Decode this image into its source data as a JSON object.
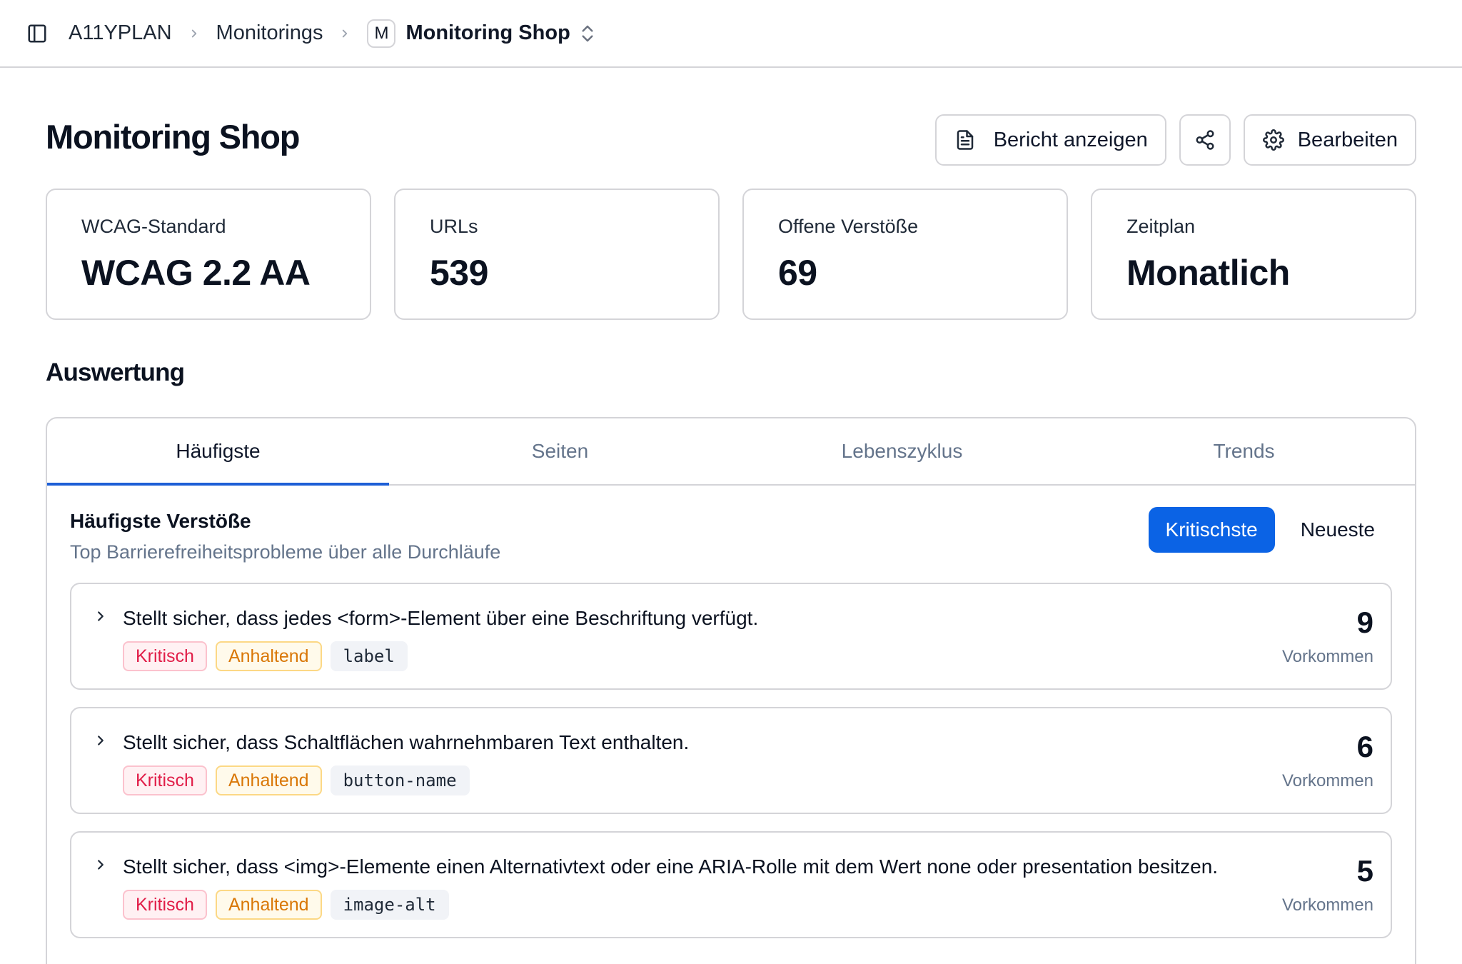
{
  "breadcrumb": {
    "org": "A11YPLAN",
    "section": "Monitorings",
    "badge": "M",
    "current": "Monitoring Shop"
  },
  "header": {
    "title": "Monitoring Shop",
    "report_label": "Bericht anzeigen",
    "edit_label": "Bearbeiten"
  },
  "stats": [
    {
      "label": "WCAG-Standard",
      "value": "WCAG 2.2 AA"
    },
    {
      "label": "URLs",
      "value": "539"
    },
    {
      "label": "Offene Verstöße",
      "value": "69"
    },
    {
      "label": "Zeitplan",
      "value": "Monatlich"
    }
  ],
  "section": {
    "title": "Auswertung"
  },
  "tabs": [
    {
      "label": "Häufigste",
      "active": true
    },
    {
      "label": "Seiten",
      "active": false
    },
    {
      "label": "Lebenszyklus",
      "active": false
    },
    {
      "label": "Trends",
      "active": false
    }
  ],
  "panel": {
    "title": "Häufigste Verstöße",
    "subtitle": "Top Barrierefreiheitsprobleme über alle Durchläufe",
    "sort_critical": "Kritischste",
    "sort_newest": "Neueste"
  },
  "issues": [
    {
      "title": "Stellt sicher, dass jedes <form>-Element über eine Beschriftung verfügt.",
      "severity": "Kritisch",
      "status": "Anhaltend",
      "rule": "label",
      "count": "9",
      "count_label": "Vorkommen"
    },
    {
      "title": "Stellt sicher, dass Schaltflächen wahrnehmbaren Text enthalten.",
      "severity": "Kritisch",
      "status": "Anhaltend",
      "rule": "button-name",
      "count": "6",
      "count_label": "Vorkommen"
    },
    {
      "title": "Stellt sicher, dass <img>-Elemente einen Alternativtext oder eine ARIA-Rolle mit dem Wert none oder presentation besitzen.",
      "severity": "Kritisch",
      "status": "Anhaltend",
      "rule": "image-alt",
      "count": "5",
      "count_label": "Vorkommen"
    }
  ],
  "colors": {
    "accent": "#0b63e5",
    "tab_underline": "#1d5fd6",
    "critical": "#e11d48",
    "ongoing": "#d97706",
    "border": "#d4d4d8"
  },
  "icons": {
    "sidebar": "sidebar-toggle-icon",
    "report": "document-icon",
    "share": "share-icon",
    "settings": "gear-icon",
    "expand": "chevron-right-icon"
  }
}
